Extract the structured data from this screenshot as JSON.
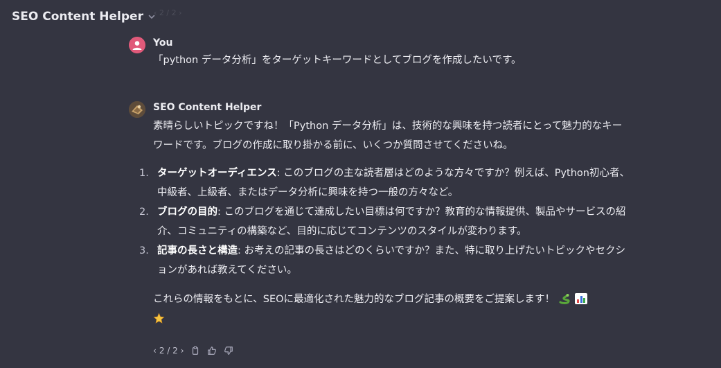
{
  "header": {
    "title": "SEO Content Helper",
    "prev_nav": "‹ 2 / 2 ›"
  },
  "user_message": {
    "author": "You",
    "text": "「python データ分析」をターゲットキーワードとしてブログを作成したいです。"
  },
  "assistant_message": {
    "author": "SEO Content Helper",
    "intro": "素晴らしいトピックですね！「Python データ分析」は、技術的な興味を持つ読者にとって魅力的なキーワードです。ブログの作成に取り掛かる前に、いくつか質問させてくださいね。",
    "items": [
      {
        "num": "1.",
        "title": "ターゲットオーディエンス",
        "text": ": このブログの主な読者層はどのような方々ですか？例えば、Python初心者、中級者、上級者、またはデータ分析に興味を持つ一般の方々など。"
      },
      {
        "num": "2.",
        "title": "ブログの目的",
        "text": ": このブログを通じて達成したい目標は何ですか？教育的な情報提供、製品やサービスの紹介、コミュニティの構築など、目的に応じてコンテンツのスタイルが変わります。"
      },
      {
        "num": "3.",
        "title": "記事の長さと構造",
        "text": ": お考えの記事の長さはどのくらいですか？また、特に取り上げたいトピックやセクションがあれば教えてください。"
      }
    ],
    "closing": "これらの情報をもとに、SEOに最適化された魅力的なブログ記事の概要をご提案します！",
    "emojis": [
      "snake-emoji",
      "bar-chart-emoji",
      "star-emoji"
    ]
  },
  "actions": {
    "prev": "‹",
    "counter": "2 / 2",
    "next": "›",
    "icons": [
      "copy-icon",
      "thumbs-up-icon",
      "thumbs-down-icon"
    ]
  },
  "colors": {
    "background": "#343541",
    "text": "#ececf1",
    "user_avatar": "#e05a7a"
  }
}
